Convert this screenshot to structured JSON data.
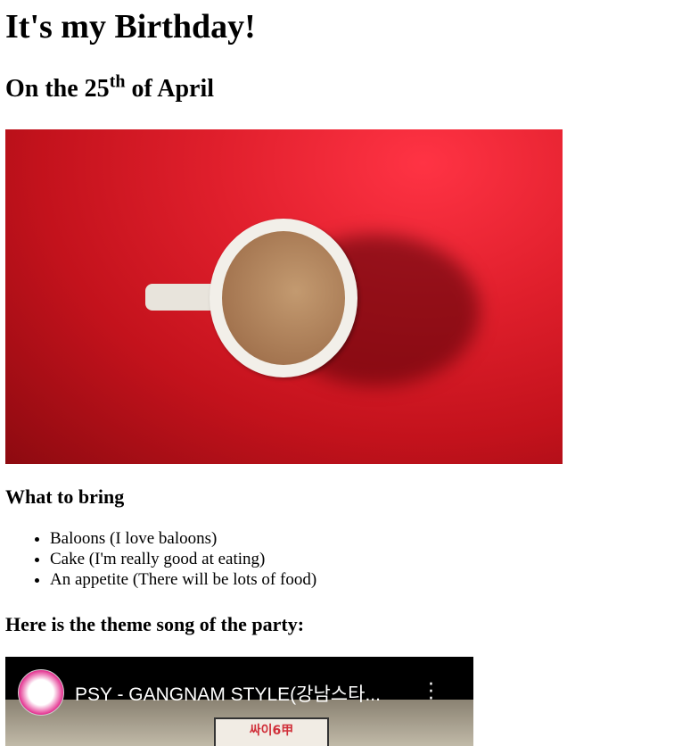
{
  "title": "It's my Birthday!",
  "date": {
    "prefix": "On the 25",
    "suffix": "th",
    "rest": " of April"
  },
  "bring_heading": "What to bring",
  "bring_items": [
    "Baloons (I love baloons)",
    "Cake (I'm really good at eating)",
    "An appetite (There will be lots of food)"
  ],
  "song_heading": "Here is the theme song of the party:",
  "video": {
    "title": "PSY - GANGNAM STYLE(강남스타...",
    "sign": "싸이6甲",
    "menu_icon": "more-vert-icon"
  }
}
